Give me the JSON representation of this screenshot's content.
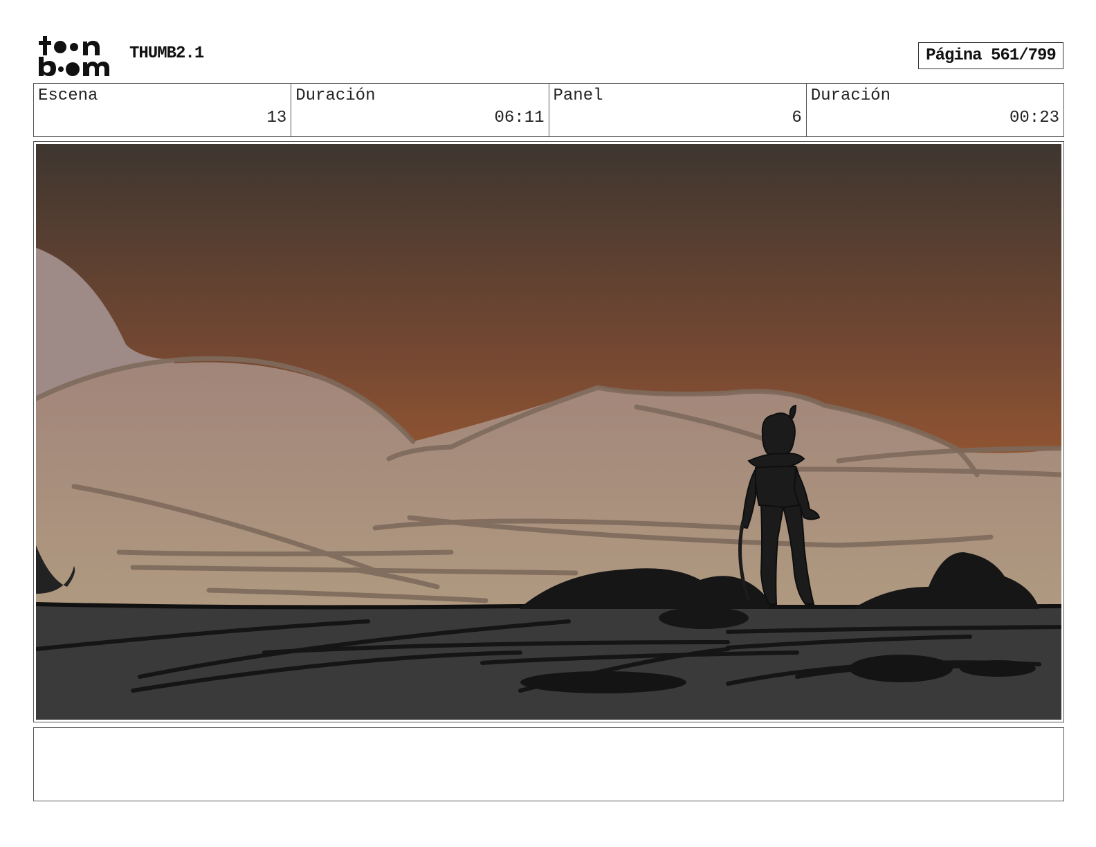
{
  "header": {
    "doc_title": "THUMB2.1",
    "page_label": "Página 561/799"
  },
  "info": [
    {
      "label": "Escena",
      "value": "13"
    },
    {
      "label": "Duración",
      "value": "06:11"
    },
    {
      "label": "Panel",
      "value": "6"
    },
    {
      "label": "Duración",
      "value": "00:23"
    }
  ],
  "colors": {
    "sky_top": "#3e3630",
    "sky_mid": "#7a4a32",
    "sky_bottom": "#b06430",
    "hills": "#a88a74",
    "ground": "#3a3a3a",
    "silhouette": "#1b1b1b"
  }
}
